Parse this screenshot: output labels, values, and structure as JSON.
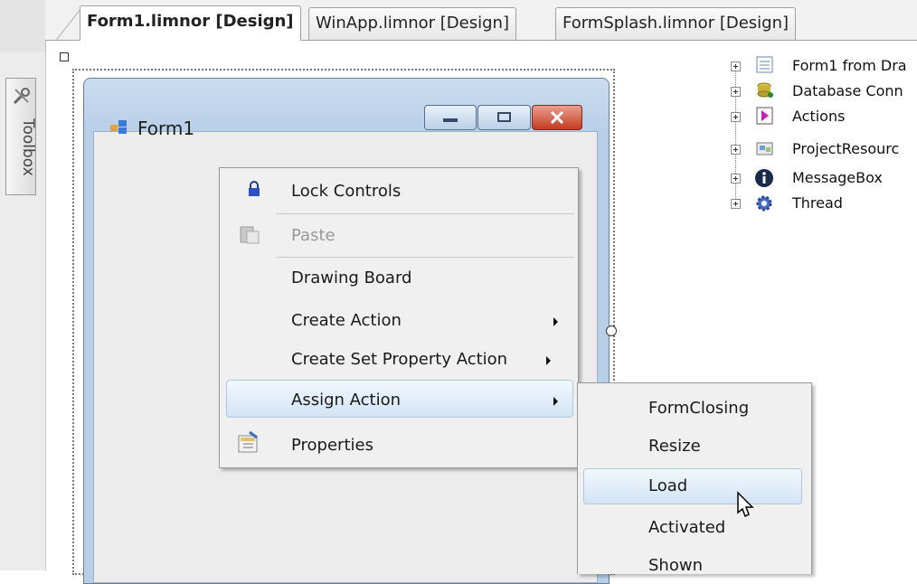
{
  "tabs": [
    {
      "label": "Form1.limnor [Design]",
      "active": true
    },
    {
      "label": "WinApp.limnor [Design]",
      "active": false
    },
    {
      "label": "FormSplash.limnor [Design]",
      "active": false
    }
  ],
  "sidebar": {
    "toolbox_label": "Toolbox",
    "icon": "toolbox-icon"
  },
  "form": {
    "title": "Form1",
    "icon": "form-icon"
  },
  "context_menu": {
    "items": [
      {
        "label": "Lock Controls",
        "icon": "lock-icon",
        "enabled": true
      },
      {
        "label": "Paste",
        "icon": "paste-icon",
        "enabled": false
      },
      {
        "label": "Drawing Board",
        "enabled": true
      },
      {
        "label": "Create Action",
        "has_submenu": true,
        "enabled": true
      },
      {
        "label": "Create Set Property Action",
        "has_submenu": true,
        "enabled": true
      },
      {
        "label": "Assign Action",
        "has_submenu": true,
        "enabled": true,
        "highlighted": true
      },
      {
        "label": "Properties",
        "icon": "properties-icon",
        "enabled": true
      }
    ]
  },
  "submenu": {
    "items": [
      {
        "label": "FormClosing"
      },
      {
        "label": "Resize"
      },
      {
        "label": "Load",
        "highlighted": true
      },
      {
        "label": "Activated"
      },
      {
        "label": "Shown"
      }
    ]
  },
  "tree": {
    "items": [
      {
        "label": "Form1 from Dra",
        "icon": "form-icon"
      },
      {
        "label": "Database Conn",
        "icon": "database-icon"
      },
      {
        "label": "Actions",
        "icon": "actions-icon"
      },
      {
        "label": "ProjectResourc",
        "icon": "resources-icon"
      },
      {
        "label": "MessageBox",
        "icon": "info-icon"
      },
      {
        "label": "Thread",
        "icon": "gear-icon"
      }
    ]
  },
  "colors": {
    "highlight": "#d3e4f5",
    "menu_bg": "#f0f0f0",
    "close_button": "#c43b22",
    "form_frame": "#b9cfe8"
  }
}
